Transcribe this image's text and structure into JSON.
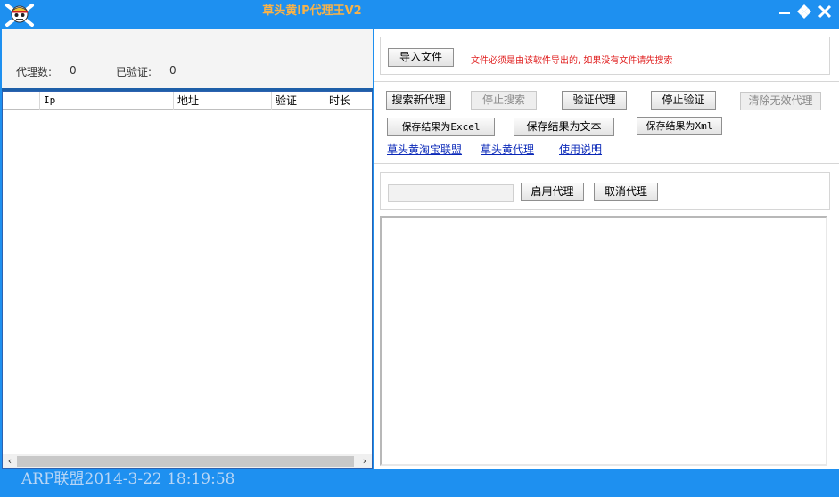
{
  "window": {
    "title": "草头黄IP代理王V2",
    "logo": "skull-crossbones-icon",
    "controls": [
      "minimize-icon",
      "move-icon",
      "close-icon"
    ],
    "colors": {
      "titlebar": "#1e90f0",
      "title_text": "#f6b24a",
      "warning": "#e02020",
      "link": "#0a28b8"
    }
  },
  "stats": {
    "proxy_count_label": "代理数:",
    "proxy_count_value": "0",
    "verified_label": "已验证:",
    "verified_value": "0"
  },
  "table": {
    "columns": [
      "",
      "Ip",
      "地址",
      "验证",
      "时长"
    ],
    "rows": []
  },
  "import": {
    "button": "导入文件",
    "note": "文件必须是由该软件导出的, 如果没有文件请先搜索"
  },
  "actions": {
    "search": "搜索新代理",
    "stop_search": "停止搜索",
    "verify": "验证代理",
    "stop_verify": "停止验证",
    "clear_invalid": "清除无效代理",
    "save_excel": "保存结果为Excel",
    "save_text": "保存结果为文本",
    "save_xml": "保存结果为Xml"
  },
  "links": {
    "taobao": "草头黄淘宝联盟",
    "proxy": "草头黄代理",
    "manual": "使用说明"
  },
  "proxy": {
    "input_value": "",
    "enable": "启用代理",
    "cancel": "取消代理"
  },
  "status_bar": "ARP联盟2014-3-22 18:19:58"
}
